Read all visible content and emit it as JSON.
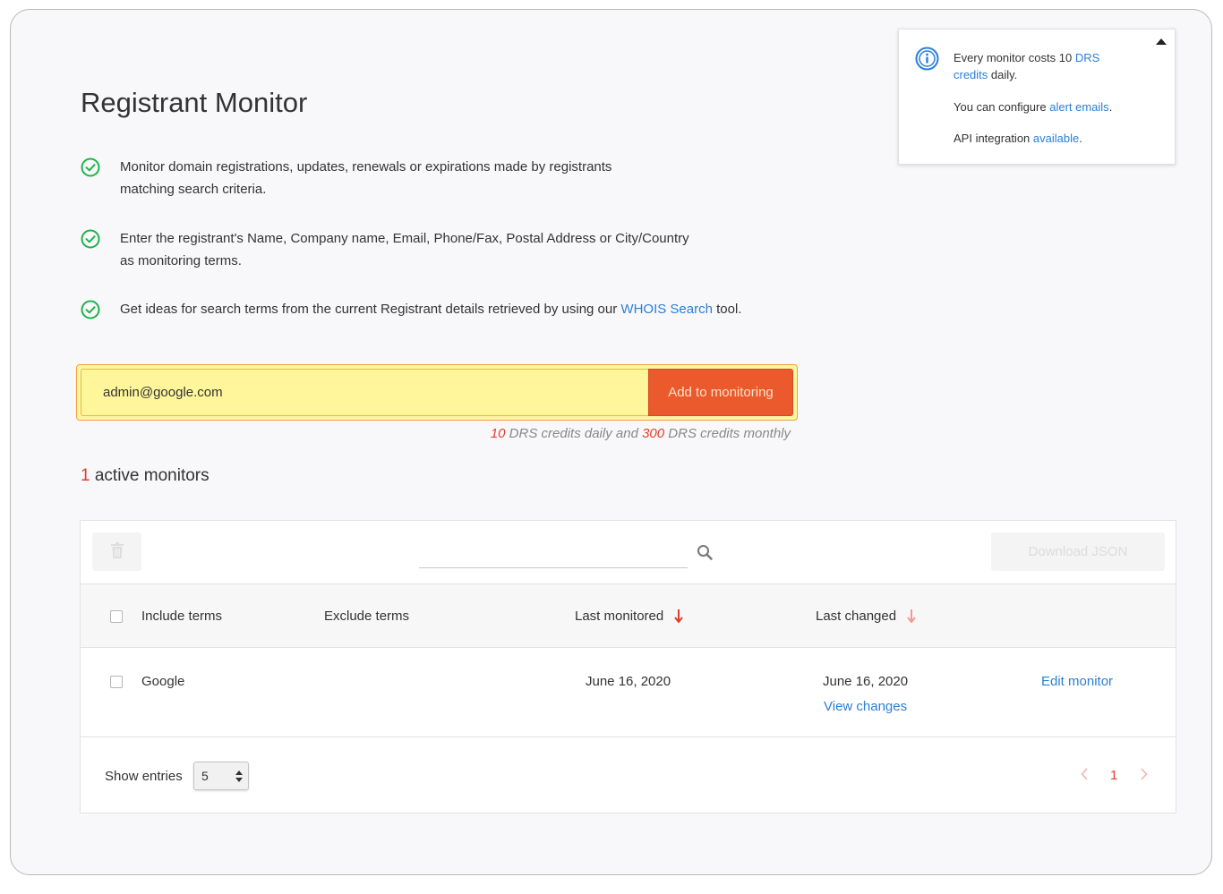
{
  "page": {
    "title": "Registrant Monitor"
  },
  "features": [
    {
      "line1": "Monitor domain registrations, updates, renewals or expirations made by registrants",
      "line2": "matching search criteria."
    },
    {
      "line1": "Enter the registrant's Name, Company name, Email, Phone/Fax, Postal Address or City/Country",
      "line2": "as monitoring terms."
    },
    {
      "before": "Get ideas for search terms from the current Registrant details retrieved by using our ",
      "link": "WHOIS Search",
      "after": " tool."
    }
  ],
  "info": {
    "line1_text": "Every monitor costs 10 ",
    "line1_link": "DRS",
    "line2_link": "credits",
    "line2_text": " daily.",
    "alerts_text": "You can configure ",
    "alerts_link": "alert emails",
    "alerts_end": ".",
    "api_text": "API integration ",
    "api_link": "available",
    "api_end": "."
  },
  "search": {
    "value": "admin@google.com",
    "button_label": "Add to monitoring"
  },
  "credits": {
    "daily": "10",
    "daily_text": " DRS credits daily and ",
    "monthly": "300",
    "monthly_text": " DRS credits monthly"
  },
  "active": {
    "count": "1",
    "label": " active monitors"
  },
  "toolbar": {
    "download_label": "Download JSON"
  },
  "table": {
    "headers": {
      "include": "Include terms",
      "exclude": "Exclude terms",
      "last_monitored": "Last monitored",
      "last_changed": "Last changed"
    },
    "rows": [
      {
        "include": "Google",
        "exclude": "",
        "last_monitored": "June 16, 2020",
        "last_changed": "June 16, 2020",
        "view_changes": "View changes",
        "edit": "Edit monitor"
      }
    ]
  },
  "footer": {
    "show_entries_label": "Show entries",
    "entries_value": "5",
    "page": "1"
  },
  "colors": {
    "accent_link": "#2a7fd8",
    "button_orange": "#eb5a2d",
    "highlight_red": "#e23d2b",
    "check_green": "#1fb24a"
  },
  "icons": [
    "check-circle-icon",
    "info-icon",
    "collapse-up-icon",
    "trash-icon",
    "search-icon",
    "sort-arrow-icon",
    "chevron-left-icon",
    "chevron-right-icon",
    "select-arrows-icon"
  ]
}
